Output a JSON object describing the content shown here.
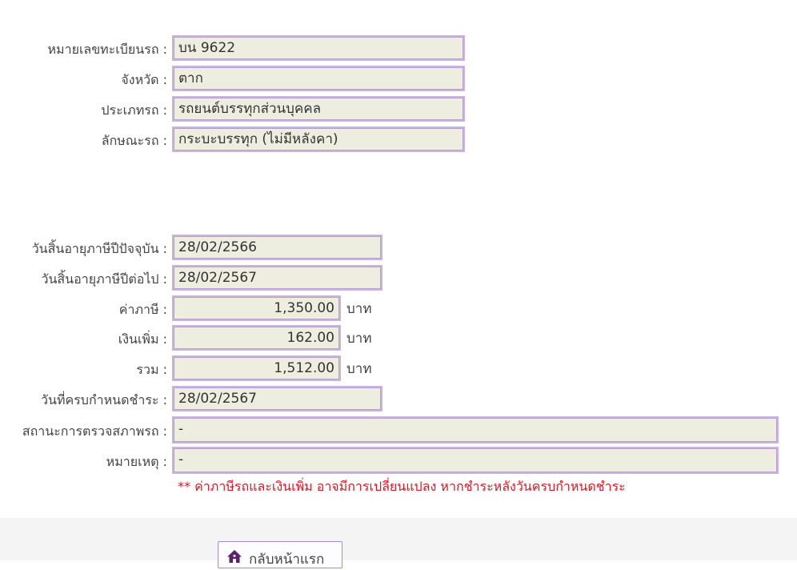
{
  "vehicle": {
    "plate_label": "หมายเลขทะเบียนรถ :",
    "plate_value": "บน 9622",
    "province_label": "จังหวัด :",
    "province_value": "ตาก",
    "type_label": "ประเภทรถ :",
    "type_value": "รถยนต์บรรทุกส่วนบุคคล",
    "body_label": "ลักษณะรถ :",
    "body_value": "กระบะบรรทุก (ไม่มีหลังคา)"
  },
  "tax": {
    "current_expiry_label": "วันสิ้นอายุภาษีปีปัจจุบัน :",
    "current_expiry_value": "28/02/2566",
    "next_expiry_label": "วันสิ้นอายุภาษีปีต่อไป :",
    "next_expiry_value": "28/02/2567",
    "tax_label": "ค่าภาษี :",
    "tax_value": "1,350.00",
    "surcharge_label": "เงินเพิ่ม :",
    "surcharge_value": "162.00",
    "total_label": "รวม :",
    "total_value": "1,512.00",
    "unit": "บาท",
    "due_label": "วันที่ครบกำหนดชำระ :",
    "due_value": "28/02/2567",
    "inspection_label": "สถานะการตรวจสภาพรถ :",
    "inspection_value": "-",
    "remark_label": "หมายเหตุ :",
    "remark_value": "-"
  },
  "note": "** ค่าภาษีรถและเงินเพิ่ม อาจมีการเปลี่ยนแปลง หากชำระหลังวันครบกำหนดชำระ",
  "footer": {
    "home_button_label": "กลับหน้าแรก",
    "home_icon": "home-icon"
  },
  "colors": {
    "field_bg": "#eeeee0",
    "field_border": "#b89ed4",
    "note_red": "#e0161c",
    "icon_purple": "#5b1f6e"
  }
}
